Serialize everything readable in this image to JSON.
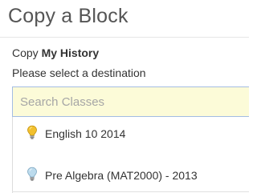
{
  "dialog": {
    "title": "Copy a Block",
    "copy_prefix": "Copy",
    "block_name": "My History",
    "destination_prompt": "Please select a destination"
  },
  "search": {
    "placeholder": "Search Classes",
    "value": ""
  },
  "classes": [
    {
      "label": "English 10 2014",
      "icon": "lightbulb-on-icon"
    },
    {
      "label": "Pre Algebra (MAT2000) - 2013",
      "icon": "lightbulb-off-icon"
    }
  ],
  "colors": {
    "search_background": "#fcfbd8",
    "search_border": "#a3bde3",
    "bulb_on": "#f2c02e",
    "bulb_off": "#9fc6de"
  }
}
